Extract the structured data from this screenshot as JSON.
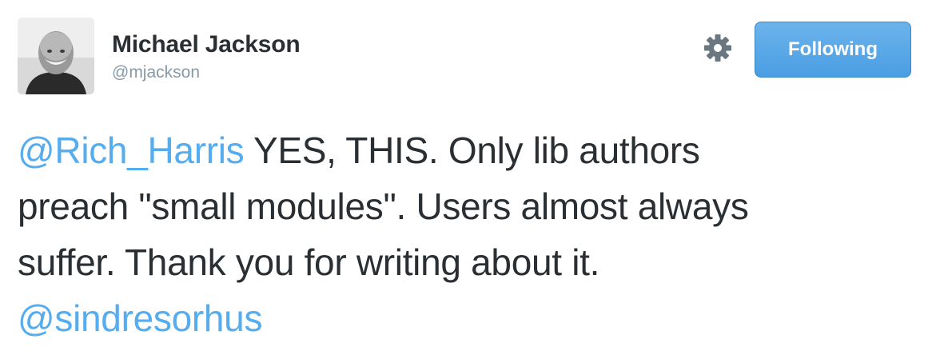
{
  "author": {
    "name": "Michael Jackson",
    "handle": "@mjackson"
  },
  "actions": {
    "settings_icon": "gear-icon",
    "follow_label": "Following"
  },
  "tweet": {
    "mention1": "@Rich_Harris",
    "line1_rest": " YES, THIS. Only lib authors",
    "line2": "preach \"small modules\". Users almost always",
    "line3": "suffer. Thank you for writing about it.",
    "mention2": "@sindresorhus"
  },
  "colors": {
    "link": "#55acee",
    "text": "#292f33",
    "muted": "#8899a6",
    "button": "#55acee"
  }
}
